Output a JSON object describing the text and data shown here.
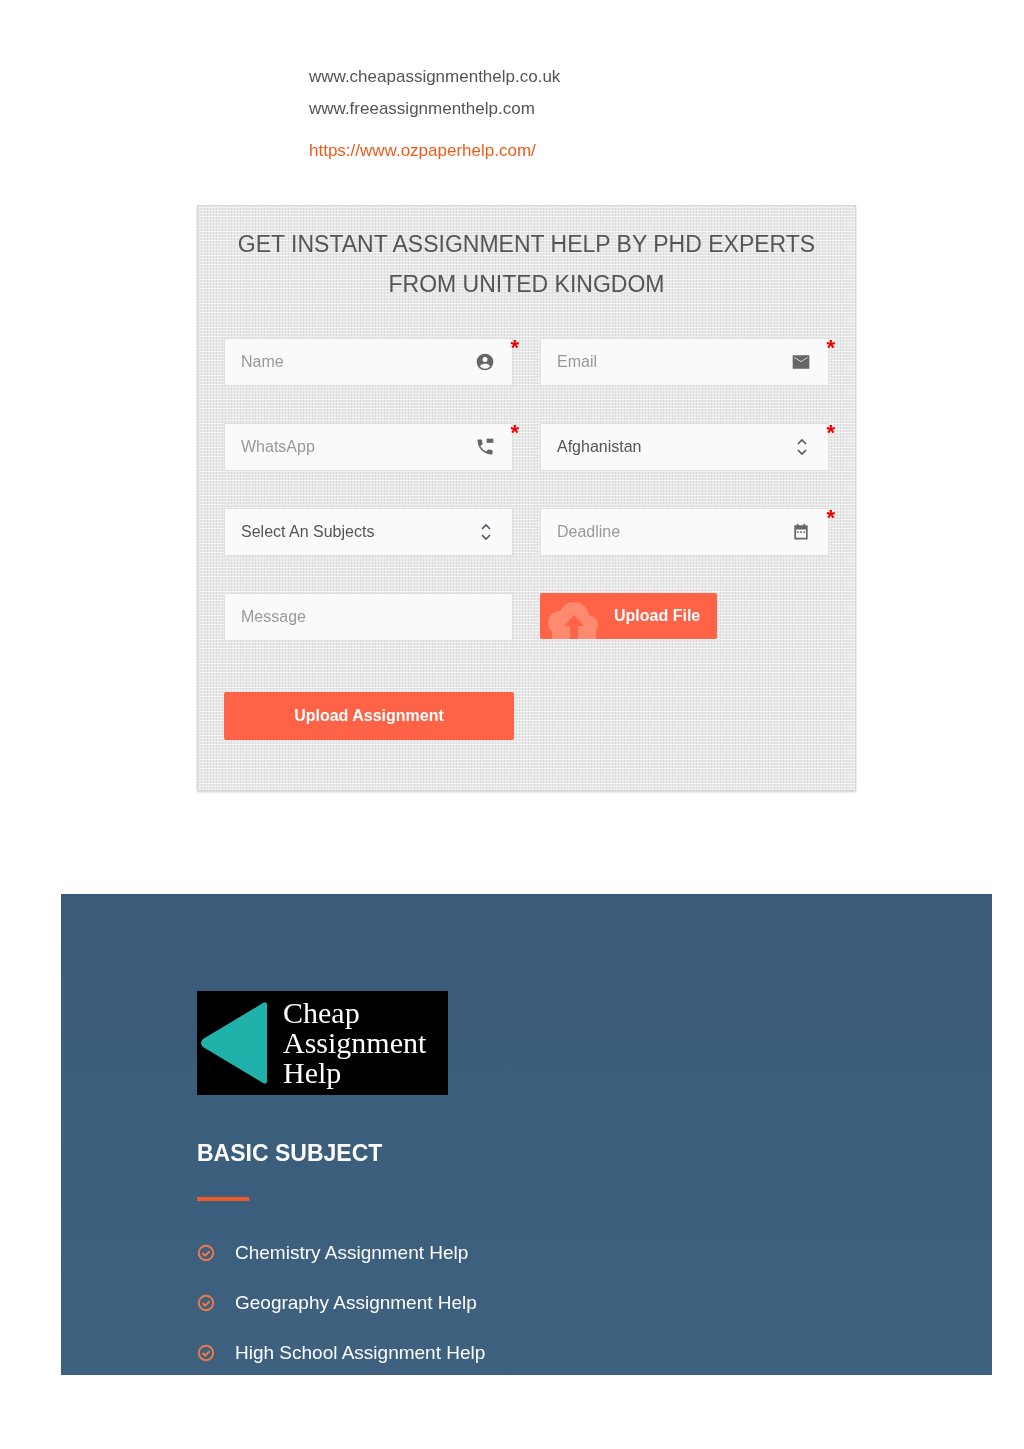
{
  "links": [
    {
      "text": "www.cheapassignmenthelp.co.uk",
      "kind": "plain"
    },
    {
      "text": "www.freeassignmenthelp.com",
      "kind": "plain"
    },
    {
      "text": "https://www.ozpaperhelp.com/",
      "kind": "link"
    }
  ],
  "form": {
    "title_lines": [
      "GET INSTANT ASSIGNMENT HELP BY PHD EXPERTS",
      "FROM UNITED KINGDOM"
    ],
    "required_mark": "*",
    "fields": [
      {
        "kind": "person",
        "placeholder": "Name",
        "required": true
      },
      {
        "kind": "email",
        "placeholder": "Email",
        "required": true
      },
      {
        "kind": "phone",
        "placeholder": "WhatsApp",
        "required": true
      },
      {
        "kind": "select",
        "value": "Afghanistan",
        "required": true
      },
      {
        "kind": "select",
        "value": "Select An Subjects",
        "required": false
      },
      {
        "kind": "date",
        "placeholder": "Deadline",
        "required": true
      },
      {
        "kind": "message",
        "placeholder": "Message",
        "required": false
      },
      {
        "kind": "upload",
        "label": "Upload File"
      }
    ],
    "submit": "Upload Assignment"
  },
  "footer": {
    "logo_lines": [
      "Cheap",
      "Assignment",
      "Help"
    ],
    "heading": "BASIC SUBJECT",
    "items": [
      "Chemistry Assignment Help",
      "Geography Assignment Help",
      "High School Assignment Help"
    ]
  }
}
